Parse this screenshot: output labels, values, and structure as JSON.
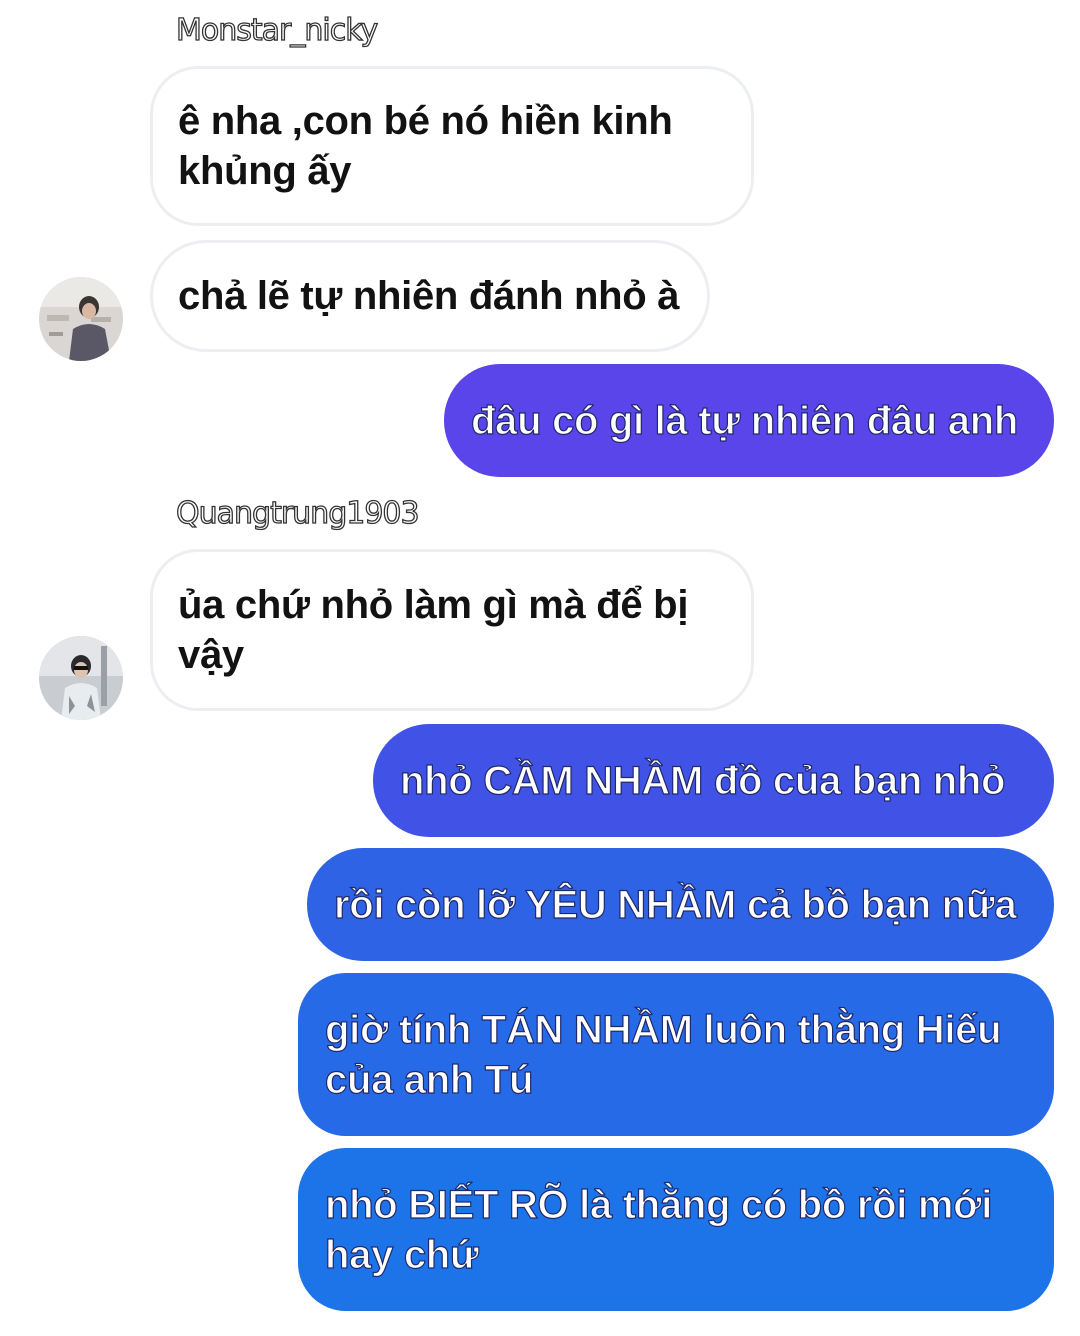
{
  "conversation": {
    "participants": {
      "monstar": {
        "name": "Monstar_nicky",
        "avatar_icon": "user-avatar-photo"
      },
      "quangtrung": {
        "name": "Quangtrung1903",
        "avatar_icon": "user-avatar-photo"
      }
    },
    "messages": [
      {
        "direction": "incoming",
        "sender": "Monstar_nicky",
        "lines": [
          "ê nha ,con bé nó hiền kinh",
          "khủng ấy"
        ]
      },
      {
        "direction": "incoming",
        "sender": "Monstar_nicky",
        "lines": [
          "chả lẽ tự nhiên đánh nhỏ à"
        ]
      },
      {
        "direction": "outgoing",
        "lines": [
          "đâu có gì là tự nhiên đâu anh"
        ]
      },
      {
        "direction": "incoming",
        "sender": "Quangtrung1903",
        "lines": [
          "ủa chứ nhỏ làm gì mà để bị",
          "vậy"
        ]
      },
      {
        "direction": "outgoing",
        "lines": [
          "nhỏ CẦM NHẦM đồ của bạn nhỏ"
        ]
      },
      {
        "direction": "outgoing",
        "lines": [
          "rồi còn lỡ YÊU NHẦM cả bồ bạn nữa"
        ]
      },
      {
        "direction": "outgoing",
        "lines": [
          "giờ tính TÁN NHẦM luôn thằng Hiếu",
          "của anh Tú"
        ]
      },
      {
        "direction": "outgoing",
        "lines": [
          "nhỏ BIẾT RÕ là thằng có bồ rồi mới",
          "hay chứ"
        ]
      }
    ]
  },
  "colors": {
    "incoming_bg": "#ffffff",
    "incoming_border": "#eceef1",
    "incoming_text": "#121212",
    "outgoing_gradient": [
      "#5a45ea",
      "#4153e6",
      "#2e63e6",
      "#266ae7",
      "#1d74e8"
    ],
    "outgoing_text": "#ffffff"
  }
}
